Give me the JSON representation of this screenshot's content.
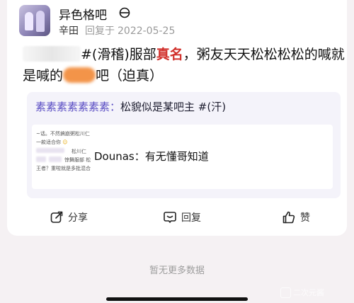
{
  "post": {
    "forum_name": "异色格吧",
    "forum_badge_icon": "forum-level-icon",
    "author": "辛田",
    "meta_reply_label": "回复于",
    "meta_date": "2022-05-25",
    "text_part1": "#(滑稽)服部",
    "text_red": "真名",
    "text_part2": "，粥友天天松松松松的喊就是喊的",
    "text_part3": "吧（迫真）"
  },
  "quote": {
    "prefix": "素素素素素素素：",
    "text": "松貌似是某吧主 #(汗)"
  },
  "screenshot": {
    "line1": "~话。不然搞崩粥松川仁",
    "line2": "一款适合你",
    "line3": "松川仁",
    "line4": "惊舞服部 松",
    "line5": "王者？重啦就是多批混合",
    "main_text": "Dounas：有无懂哥知道"
  },
  "actions": {
    "share_label": "分享",
    "reply_label": "回复",
    "like_label": "赞"
  },
  "footer": {
    "no_more": "暂无更多数据",
    "watermark": "二次元酱"
  },
  "colors": {
    "accent_red": "#d1302b",
    "quote_accent": "#5b4fc4",
    "blur_orange": "#f39449",
    "background": "#f5f1f3"
  }
}
